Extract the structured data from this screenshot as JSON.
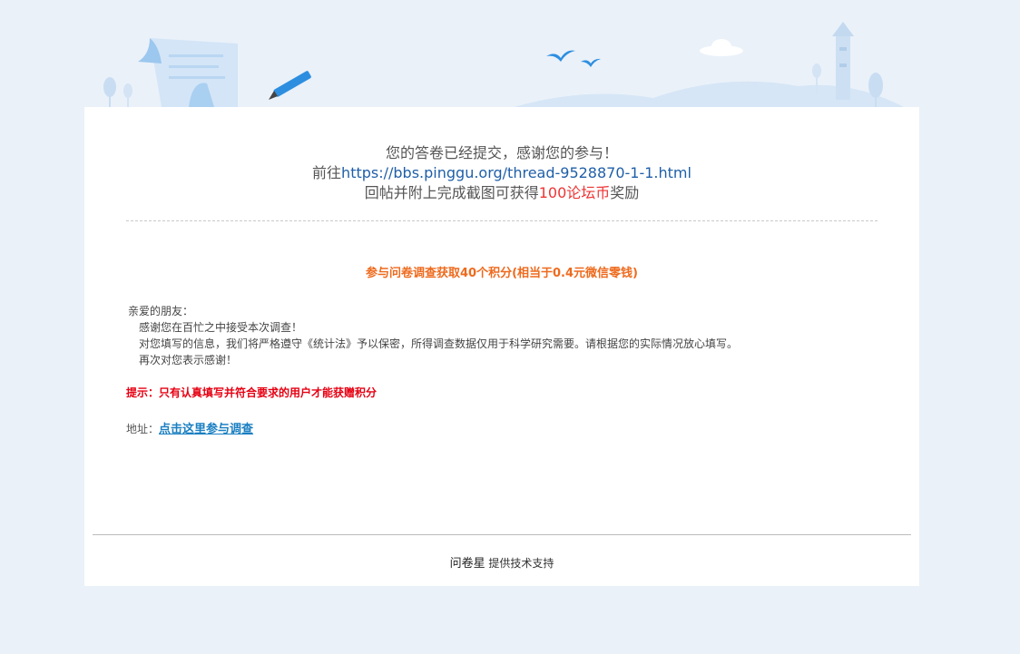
{
  "thanks": {
    "line1": "您的答卷已经提交，感谢您的参与！",
    "line2_prefix": "前往",
    "line2_link": "https://bbs.pinggu.org/thread-9528870-1-1.html",
    "line3_prefix": "回帖并附上完成截图可获得",
    "line3_highlight": "100论坛币",
    "line3_suffix": "奖励"
  },
  "survey": {
    "title": "参与问卷调查获取40个积分(相当于0.4元微信零钱)",
    "greeting": "亲爱的朋友：",
    "para1": "感谢您在百忙之中接受本次调查！",
    "para2": "对您填写的信息，我们将严格遵守《统计法》予以保密，所得调查数据仅用于科学研究需要。请根据您的实际情况放心填写。",
    "para3": "再次对您表示感谢！",
    "tip": "提示：只有认真填写并符合要求的用户才能获赠积分",
    "address_label": "地址：",
    "address_link": "点击这里参与调查"
  },
  "footer": {
    "brand": "问卷星",
    "text": "提供技术支持"
  },
  "colors": {
    "background": "#eaf1f9",
    "link_blue": "#1f5fa8",
    "highlight_red": "#ee3333",
    "title_orange": "#ee6a1d",
    "tip_red": "#e60012",
    "address_link": "#1a7fc1"
  },
  "icons": [
    "scroll-illustration",
    "pencil-illustration",
    "bird-icon",
    "cloud-icon",
    "lighthouse-illustration",
    "tree-icon"
  ]
}
